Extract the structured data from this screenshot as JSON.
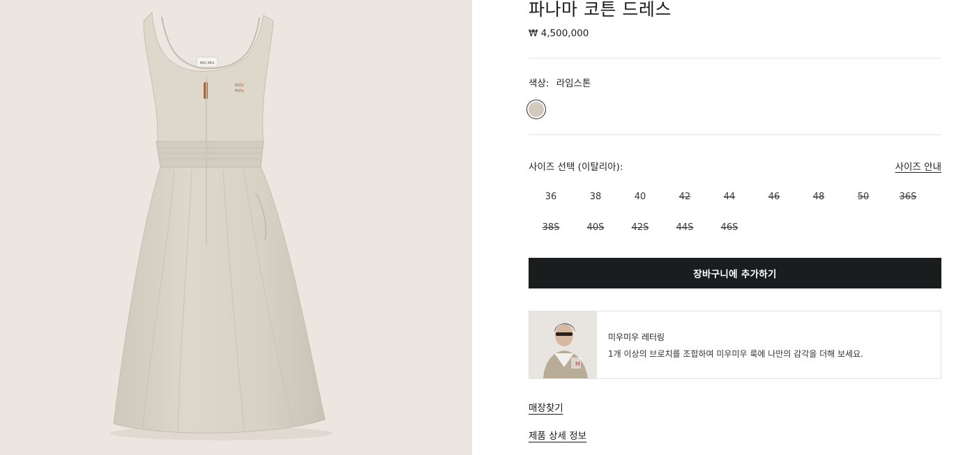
{
  "product": {
    "title": "파나마 코튼 드레스",
    "price": "₩ 4,500,000",
    "label_text": "MIU MIU"
  },
  "color": {
    "label": "색상:",
    "value": "라임스톤",
    "swatch_hex": "#d4c9bd"
  },
  "size": {
    "heading": "사이즈 선택 (이탈리아):",
    "guide_link": "사이즈 안내",
    "options": [
      {
        "label": "36",
        "available": true
      },
      {
        "label": "38",
        "available": true
      },
      {
        "label": "40",
        "available": true
      },
      {
        "label": "42",
        "available": false
      },
      {
        "label": "44",
        "available": false
      },
      {
        "label": "46",
        "available": false
      },
      {
        "label": "48",
        "available": false
      },
      {
        "label": "50",
        "available": false
      },
      {
        "label": "36S",
        "available": false
      },
      {
        "label": "38S",
        "available": false
      },
      {
        "label": "40S",
        "available": false
      },
      {
        "label": "42S",
        "available": false
      },
      {
        "label": "44S",
        "available": false
      },
      {
        "label": "46S",
        "available": false
      }
    ]
  },
  "cart": {
    "button_label": "장바구니에 추가하기"
  },
  "promo": {
    "title": "미우미우 레터링",
    "description": "1개 이상의 브로치를 조합하여 미우미우 룩에 나만의 감각을 더해 보세요."
  },
  "links": {
    "store_finder": "매장찾기",
    "product_details": "제품 상세 정보"
  },
  "colors": {
    "button_bg": "#1b1c1e",
    "image_bg": "#ebe6df",
    "dress": "#d9d3c8"
  }
}
